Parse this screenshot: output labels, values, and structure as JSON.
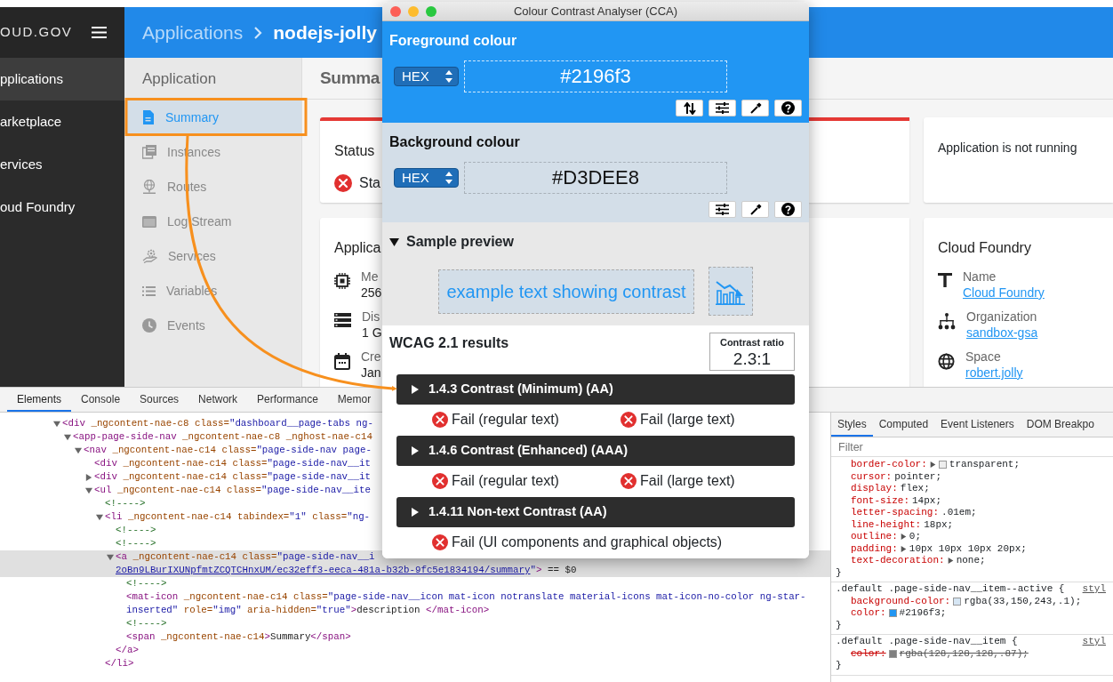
{
  "app": {
    "brand": "OUD.GOV",
    "main_nav": [
      {
        "label": "pplications",
        "selected": true
      },
      {
        "label": "arketplace",
        "selected": false
      },
      {
        "label": "ervices",
        "selected": false
      },
      {
        "label": "oud Foundry",
        "selected": false
      }
    ],
    "breadcrumb": [
      "Applications",
      "nodejs-jolly"
    ],
    "side_nav": {
      "title": "Application",
      "items": [
        {
          "label": "Summary",
          "selected": true
        },
        {
          "label": "Instances",
          "selected": false
        },
        {
          "label": "Routes",
          "selected": false
        },
        {
          "label": "Log Stream",
          "selected": false
        },
        {
          "label": "Services",
          "selected": false
        },
        {
          "label": "Variables",
          "selected": false
        },
        {
          "label": "Events",
          "selected": false
        }
      ]
    },
    "page_title": "Summa",
    "status_card": {
      "title": "Status",
      "running": false,
      "value": "Sta"
    },
    "notice_card": {
      "text": "Application is not running"
    },
    "app_card": {
      "title": "Applica",
      "details": [
        {
          "label": "Me",
          "value": "256"
        },
        {
          "label": "Dis",
          "value": "1 G"
        },
        {
          "label": "Cre",
          "value": "Jan"
        }
      ]
    },
    "cf_card": {
      "title": "Cloud Foundry",
      "details": [
        {
          "label": "Name",
          "value": "Cloud Foundry"
        },
        {
          "label": "Organization",
          "value": "sandbox-gsa"
        },
        {
          "label": "Space",
          "value": "robert.jolly"
        }
      ]
    }
  },
  "cca": {
    "title": "Colour Contrast Analyser (CCA)",
    "foreground": {
      "heading": "Foreground colour",
      "format": "HEX",
      "value": "#2196f3"
    },
    "background": {
      "heading": "Background colour",
      "format": "HEX",
      "value": "#D3DEE8"
    },
    "sample": {
      "heading": "Sample preview",
      "expanded": true,
      "text": "example text showing contrast"
    },
    "results": {
      "heading": "WCAG 2.1 results",
      "ratio_label": "Contrast ratio",
      "ratio": "2.3:1",
      "criteria": [
        {
          "title": "1.4.3 Contrast (Minimum) (AA)",
          "expanded": false,
          "results": [
            {
              "label": "Fail (regular text)",
              "pass": false
            },
            {
              "label": "Fail (large text)",
              "pass": false
            }
          ]
        },
        {
          "title": "1.4.6 Contrast (Enhanced) (AAA)",
          "expanded": false,
          "results": [
            {
              "label": "Fail (regular text)",
              "pass": false
            },
            {
              "label": "Fail (large text)",
              "pass": false
            }
          ]
        },
        {
          "title": "1.4.11 Non-text Contrast (AA)",
          "expanded": false,
          "results": [
            {
              "label": "Fail (UI components and graphical objects)",
              "pass": false
            }
          ]
        }
      ]
    }
  },
  "devtools": {
    "tabs": [
      {
        "label": "Elements",
        "selected": true
      },
      {
        "label": "Console",
        "selected": false
      },
      {
        "label": "Sources",
        "selected": false
      },
      {
        "label": "Network",
        "selected": false
      },
      {
        "label": "Performance",
        "selected": false
      },
      {
        "label": "Memor",
        "selected": false
      }
    ],
    "elements": [
      {
        "expanded": true,
        "selected": false,
        "lines": [
          [
            {
              "kind": "tag",
              "text": "<div"
            },
            {
              "kind": "attr",
              "text": " _ngcontent-nae-c8 class="
            },
            {
              "kind": "val",
              "text": "\"dashboard__page-tabs ng-"
            }
          ]
        ],
        "children": [
          {
            "expanded": true,
            "selected": false,
            "lines": [
              [
                {
                  "kind": "tag",
                  "text": "<app-page-side-nav"
                },
                {
                  "kind": "attr",
                  "text": " _ngcontent-nae-c8 _nghost-nae-c14"
                }
              ]
            ],
            "children": [
              {
                "expanded": true,
                "selected": false,
                "lines": [
                  [
                    {
                      "kind": "tag",
                      "text": "<nav"
                    },
                    {
                      "kind": "attr",
                      "text": " _ngcontent-nae-c14 class="
                    },
                    {
                      "kind": "val",
                      "text": "\"page-side-nav page-"
                    }
                  ]
                ],
                "children": [
                  {
                    "selected": false,
                    "lines": [
                      [
                        {
                          "kind": "tag",
                          "text": "<div"
                        },
                        {
                          "kind": "attr",
                          "text": " _ngcontent-nae-c14 class="
                        },
                        {
                          "kind": "val",
                          "text": "\"page-side-nav__it"
                        }
                      ]
                    ]
                  },
                  {
                    "expanded": false,
                    "selected": false,
                    "lines": [
                      [
                        {
                          "kind": "tag",
                          "text": "<div"
                        },
                        {
                          "kind": "attr",
                          "text": " _ngcontent-nae-c14 class="
                        },
                        {
                          "kind": "val",
                          "text": "\"page-side-nav__it"
                        }
                      ]
                    ]
                  },
                  {
                    "expanded": true,
                    "selected": false,
                    "lines": [
                      [
                        {
                          "kind": "tag",
                          "text": "<ul"
                        },
                        {
                          "kind": "attr",
                          "text": " _ngcontent-nae-c14 class="
                        },
                        {
                          "kind": "val",
                          "text": "\"page-side-nav__ite"
                        }
                      ]
                    ],
                    "children": [
                      {
                        "selected": false,
                        "lines": [
                          [
                            {
                              "kind": "cmt",
                              "text": "<!---->"
                            }
                          ]
                        ]
                      },
                      {
                        "expanded": true,
                        "selected": false,
                        "lines": [
                          [
                            {
                              "kind": "tag",
                              "text": "<li"
                            },
                            {
                              "kind": "attr",
                              "text": " _ngcontent-nae-c14 tabindex="
                            },
                            {
                              "kind": "val",
                              "text": "\"1\""
                            },
                            {
                              "kind": "attr",
                              "text": " class="
                            },
                            {
                              "kind": "val",
                              "text": "\"ng-"
                            }
                          ]
                        ],
                        "children": [
                          {
                            "selected": false,
                            "lines": [
                              [
                                {
                                  "kind": "cmt",
                                  "text": "<!---->"
                                }
                              ]
                            ]
                          },
                          {
                            "selected": false,
                            "lines": [
                              [
                                {
                                  "kind": "cmt",
                                  "text": "<!---->"
                                }
                              ]
                            ]
                          },
                          {
                            "expanded": true,
                            "selected": true,
                            "lines": [
                              [
                                {
                                  "kind": "tag",
                                  "text": "<a"
                                },
                                {
                                  "kind": "attr",
                                  "text": " _ngcontent-nae-c14 class="
                                },
                                {
                                  "kind": "val",
                                  "text": "\"page-side-nav__i"
                                }
                              ],
                              [
                                {
                                  "kind": "link",
                                  "text": "2oBn9LBurIXUNpfmtZCQTCHnxUM/ec32eff3-eeca-481a-b32b-9fc5e1834194/summary"
                                },
                                {
                                  "kind": "val",
                                  "text": "\""
                                },
                                {
                                  "kind": "tag",
                                  "text": ">"
                                },
                                {
                                  "kind": "txt",
                                  "text": " == $0"
                                }
                              ]
                            ],
                            "children": [
                              {
                                "selected": false,
                                "lines": [
                                  [
                                    {
                                      "kind": "cmt",
                                      "text": "<!---->"
                                    }
                                  ]
                                ]
                              },
                              {
                                "selected": false,
                                "lines": [
                                  [
                                    {
                                      "kind": "tag",
                                      "text": "<mat-icon"
                                    },
                                    {
                                      "kind": "attr",
                                      "text": " _ngcontent-nae-c14 class="
                                    },
                                    {
                                      "kind": "val",
                                      "text": "\"page-side-nav__icon mat-icon notranslate material-icons mat-icon-no-color ng-star-"
                                    }
                                  ],
                                  [
                                    {
                                      "kind": "val",
                                      "text": "inserted\""
                                    },
                                    {
                                      "kind": "attr",
                                      "text": " role="
                                    },
                                    {
                                      "kind": "val",
                                      "text": "\"img\""
                                    },
                                    {
                                      "kind": "attr",
                                      "text": " aria-hidden="
                                    },
                                    {
                                      "kind": "val",
                                      "text": "\"true\""
                                    },
                                    {
                                      "kind": "tag",
                                      "text": ">"
                                    },
                                    {
                                      "kind": "txt",
                                      "text": "description "
                                    },
                                    {
                                      "kind": "tag",
                                      "text": "</mat-icon>"
                                    }
                                  ]
                                ]
                              },
                              {
                                "selected": false,
                                "lines": [
                                  [
                                    {
                                      "kind": "cmt",
                                      "text": "<!---->"
                                    }
                                  ]
                                ]
                              },
                              {
                                "selected": false,
                                "lines": [
                                  [
                                    {
                                      "kind": "tag",
                                      "text": "<span"
                                    },
                                    {
                                      "kind": "attr",
                                      "text": " _ngcontent-nae-c14"
                                    },
                                    {
                                      "kind": "tag",
                                      "text": ">"
                                    },
                                    {
                                      "kind": "txt",
                                      "text": "Summary"
                                    },
                                    {
                                      "kind": "tag",
                                      "text": "</span>"
                                    }
                                  ]
                                ]
                              }
                            ]
                          },
                          {
                            "selected": false,
                            "lines": [
                              [
                                {
                                  "kind": "tag",
                                  "text": "</a>"
                                }
                              ]
                            ]
                          }
                        ]
                      },
                      {
                        "selected": false,
                        "lines": [
                          [
                            {
                              "kind": "tag",
                              "text": "</li>"
                            }
                          ]
                        ]
                      }
                    ]
                  }
                ]
              }
            ]
          }
        ]
      }
    ],
    "styles": {
      "tabs": [
        {
          "label": "Styles",
          "selected": true
        },
        {
          "label": "Computed",
          "selected": false
        },
        {
          "label": "Event Listeners",
          "selected": false
        },
        {
          "label": "DOM Breakpo",
          "selected": false
        }
      ],
      "filter": {
        "placeholder": "Filter"
      },
      "rules": [
        {
          "declarations": [
            {
              "property": "border-color:",
              "value": "transparent;",
              "expandable": true,
              "color": "#eeeeee",
              "struck": false
            },
            {
              "property": "cursor:",
              "value": "pointer;",
              "expandable": false,
              "struck": false
            },
            {
              "property": "display:",
              "value": "flex;",
              "expandable": false,
              "struck": false
            },
            {
              "property": "font-size:",
              "value": "14px;",
              "expandable": false,
              "struck": false
            },
            {
              "property": "letter-spacing:",
              "value": ".01em;",
              "expandable": false,
              "struck": false
            },
            {
              "property": "line-height:",
              "value": "18px;",
              "expandable": false,
              "struck": false
            },
            {
              "property": "outline:",
              "value": "0;",
              "expandable": true,
              "struck": false
            },
            {
              "property": "padding:",
              "value": "10px 10px 10px 20px;",
              "expandable": true,
              "struck": false
            },
            {
              "property": "text-decoration:",
              "value": "none;",
              "expandable": true,
              "struck": false
            }
          ],
          "close": "}"
        },
        {
          "selector": ".default .page-side-nav__item--active {",
          "source": "styl",
          "declarations": [
            {
              "property": "background-color:",
              "value": "rgba(33,150,243,.1);",
              "expandable": false,
              "color": "#d6e6f4",
              "struck": false
            },
            {
              "property": "color:",
              "value": "#2196f3;",
              "expandable": false,
              "color": "#2196f3",
              "struck": false
            }
          ],
          "close": "}"
        },
        {
          "selector": ".default .page-side-nav__item {",
          "source": "styl",
          "declarations": [
            {
              "property": "color:",
              "value": "rgba(128,128,128,.87);",
              "expandable": false,
              "color": "#808080",
              "struck": true
            }
          ],
          "close": "}"
        }
      ]
    }
  }
}
